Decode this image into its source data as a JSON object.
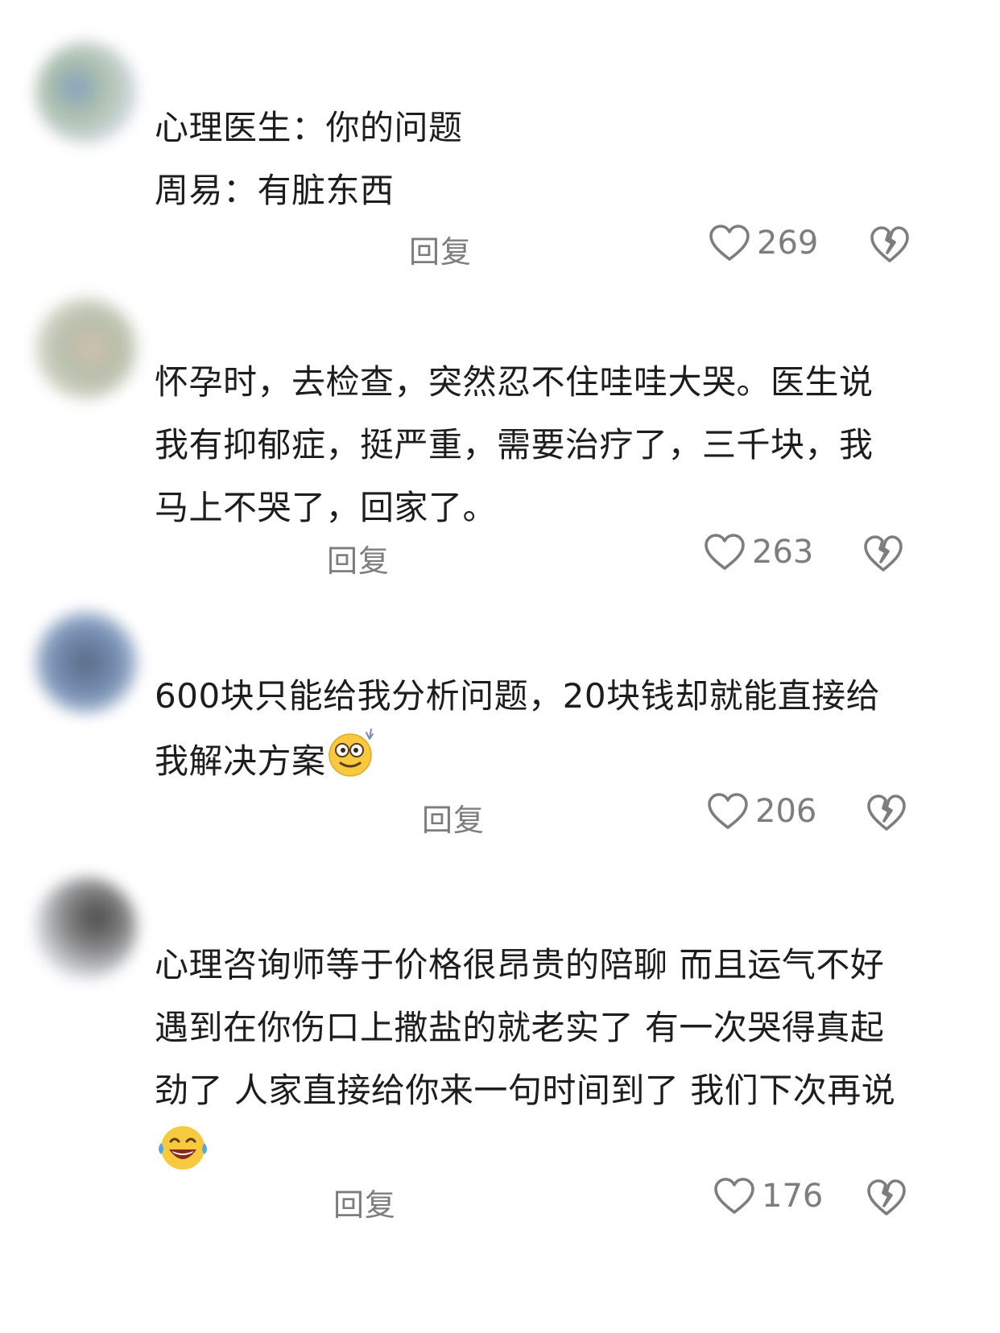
{
  "colors": {
    "text": "#1d1d1d",
    "meta": "#7d7d7d",
    "icon_stroke": "#7d7d7d",
    "emoji_yellow": "#f7c93e"
  },
  "comments": [
    {
      "lines": [
        "心理医生：你的问题",
        "周易：有脏东西"
      ],
      "reply_label": "回复",
      "likes": "269"
    },
    {
      "lines": [
        "怀孕时，去检查，突然忍不住哇哇大哭。医生说",
        "我有抑郁症，挺严重，需要治疗了，三千块，我",
        "马上不哭了，回家了。"
      ],
      "reply_label": "回复",
      "likes": "263"
    },
    {
      "lines": [
        "600块只能给我分析问题，20块钱却就能直接给",
        "我解决方案"
      ],
      "emoji": "dizzy-eyes-emoji",
      "reply_label": "回复",
      "likes": "206"
    },
    {
      "lines": [
        "心理咨询师等于价格很昂贵的陪聊 而且运气不好",
        "遇到在你伤口上撒盐的就老实了 有一次哭得真起",
        "劲了 人家直接给你来一句时间到了 我们下次再说"
      ],
      "emoji": "laughing-crying-emoji",
      "reply_label": "回复",
      "likes": "176"
    }
  ]
}
